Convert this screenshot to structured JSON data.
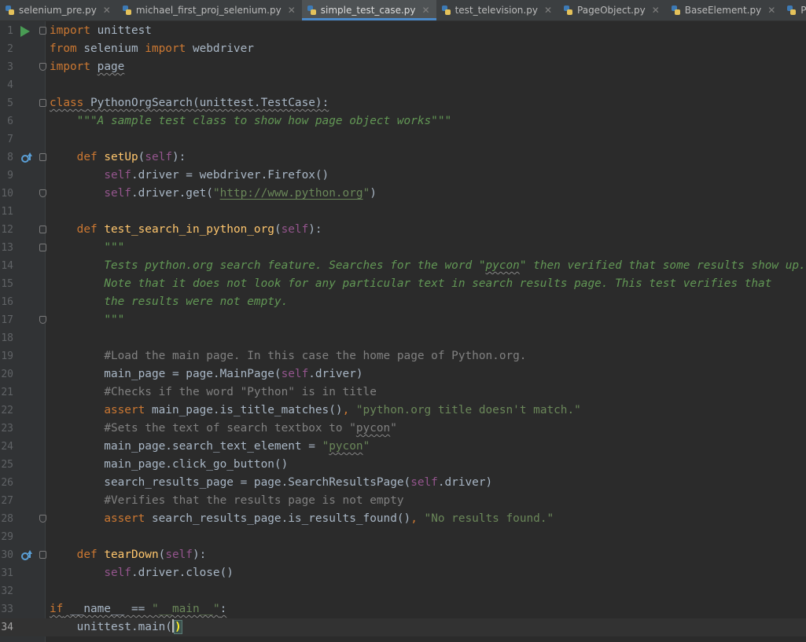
{
  "tabs": [
    {
      "label": "selenium_pre.py",
      "active": false
    },
    {
      "label": "michael_first_proj_selenium.py",
      "active": false
    },
    {
      "label": "simple_test_case.py",
      "active": true
    },
    {
      "label": "test_television.py",
      "active": false
    },
    {
      "label": "PageObject.py",
      "active": false
    },
    {
      "label": "BaseElement.py",
      "active": false
    },
    {
      "label": "PO_run.py",
      "active": false
    }
  ],
  "close_glyph": "✕",
  "current_line": 34,
  "lines": [
    {
      "n": "1",
      "code": [
        {
          "t": "kw",
          "s": "import"
        },
        {
          "t": "",
          "s": " unittest"
        }
      ]
    },
    {
      "n": "2",
      "code": [
        {
          "t": "kw",
          "s": "from"
        },
        {
          "t": "",
          "s": " selenium "
        },
        {
          "t": "kw",
          "s": "import"
        },
        {
          "t": "",
          "s": " webdriver"
        }
      ]
    },
    {
      "n": "3",
      "code": [
        {
          "t": "kw",
          "s": "import"
        },
        {
          "t": "",
          "s": " "
        },
        {
          "t": "wavy",
          "s": "page"
        }
      ]
    },
    {
      "n": "4",
      "code": []
    },
    {
      "n": "5",
      "code": [
        {
          "t": "kw wavy",
          "s": "class"
        },
        {
          "t": "wavy",
          "s": " PythonOrgSearch(unittest.TestCase):"
        }
      ]
    },
    {
      "n": "6",
      "code": [
        {
          "t": "",
          "s": "    "
        },
        {
          "t": "doc",
          "s": "\"\"\"A sample test class to show how page object works\"\"\""
        }
      ]
    },
    {
      "n": "7",
      "code": []
    },
    {
      "n": "8",
      "code": [
        {
          "t": "",
          "s": "    "
        },
        {
          "t": "kw",
          "s": "def"
        },
        {
          "t": "",
          "s": " "
        },
        {
          "t": "fn",
          "s": "setUp"
        },
        {
          "t": "",
          "s": "("
        },
        {
          "t": "self",
          "s": "self"
        },
        {
          "t": "",
          "s": "):"
        }
      ]
    },
    {
      "n": "9",
      "code": [
        {
          "t": "",
          "s": "        "
        },
        {
          "t": "self",
          "s": "self"
        },
        {
          "t": "",
          "s": ".driver = webdriver.Firefox()"
        }
      ]
    },
    {
      "n": "10",
      "code": [
        {
          "t": "",
          "s": "        "
        },
        {
          "t": "self",
          "s": "self"
        },
        {
          "t": "",
          "s": ".driver.get("
        },
        {
          "t": "str",
          "s": "\""
        },
        {
          "t": "str url",
          "s": "http://www.python.org"
        },
        {
          "t": "str",
          "s": "\""
        },
        {
          "t": "",
          "s": ")"
        }
      ]
    },
    {
      "n": "11",
      "code": []
    },
    {
      "n": "12",
      "code": [
        {
          "t": "",
          "s": "    "
        },
        {
          "t": "kw",
          "s": "def"
        },
        {
          "t": "",
          "s": " "
        },
        {
          "t": "fn",
          "s": "test_search_in_python_org"
        },
        {
          "t": "",
          "s": "("
        },
        {
          "t": "self",
          "s": "self"
        },
        {
          "t": "",
          "s": "):"
        }
      ]
    },
    {
      "n": "13",
      "code": [
        {
          "t": "",
          "s": "        "
        },
        {
          "t": "doc",
          "s": "\"\"\""
        }
      ]
    },
    {
      "n": "14",
      "code": [
        {
          "t": "",
          "s": "        "
        },
        {
          "t": "doc",
          "s": "Tests python.org search feature. Searches for the word \""
        },
        {
          "t": "doc wavy",
          "s": "pycon"
        },
        {
          "t": "doc",
          "s": "\" then verified that some results show up."
        }
      ]
    },
    {
      "n": "15",
      "code": [
        {
          "t": "",
          "s": "        "
        },
        {
          "t": "doc",
          "s": "Note that it does not look for any particular text in search results page. This test verifies that"
        }
      ]
    },
    {
      "n": "16",
      "code": [
        {
          "t": "",
          "s": "        "
        },
        {
          "t": "doc",
          "s": "the results were not empty."
        }
      ]
    },
    {
      "n": "17",
      "code": [
        {
          "t": "",
          "s": "        "
        },
        {
          "t": "doc",
          "s": "\"\"\""
        }
      ]
    },
    {
      "n": "18",
      "code": []
    },
    {
      "n": "19",
      "code": [
        {
          "t": "",
          "s": "        "
        },
        {
          "t": "cmt",
          "s": "#Load the main page. In this case the home page of Python.org."
        }
      ]
    },
    {
      "n": "20",
      "code": [
        {
          "t": "",
          "s": "        main_page = page.MainPage("
        },
        {
          "t": "self",
          "s": "self"
        },
        {
          "t": "",
          "s": ".driver)"
        }
      ]
    },
    {
      "n": "21",
      "code": [
        {
          "t": "",
          "s": "        "
        },
        {
          "t": "cmt",
          "s": "#Checks if the word \"Python\" is in title"
        }
      ]
    },
    {
      "n": "22",
      "code": [
        {
          "t": "",
          "s": "        "
        },
        {
          "t": "kw",
          "s": "assert"
        },
        {
          "t": "",
          "s": " main_page.is_title_matches()"
        },
        {
          "t": "kw",
          "s": ", "
        },
        {
          "t": "str",
          "s": "\"python.org title doesn't match.\""
        }
      ]
    },
    {
      "n": "23",
      "code": [
        {
          "t": "",
          "s": "        "
        },
        {
          "t": "cmt",
          "s": "#Sets the text of search textbox to \""
        },
        {
          "t": "cmt wavy",
          "s": "pycon"
        },
        {
          "t": "cmt",
          "s": "\""
        }
      ]
    },
    {
      "n": "24",
      "code": [
        {
          "t": "",
          "s": "        main_page.search_text_element = "
        },
        {
          "t": "str",
          "s": "\""
        },
        {
          "t": "str wavy",
          "s": "pycon"
        },
        {
          "t": "str",
          "s": "\""
        }
      ]
    },
    {
      "n": "25",
      "code": [
        {
          "t": "",
          "s": "        main_page.click_go_button()"
        }
      ]
    },
    {
      "n": "26",
      "code": [
        {
          "t": "",
          "s": "        search_results_page = page.SearchResultsPage("
        },
        {
          "t": "self",
          "s": "self"
        },
        {
          "t": "",
          "s": ".driver)"
        }
      ]
    },
    {
      "n": "27",
      "code": [
        {
          "t": "",
          "s": "        "
        },
        {
          "t": "cmt",
          "s": "#Verifies that the results page is not empty"
        }
      ]
    },
    {
      "n": "28",
      "code": [
        {
          "t": "",
          "s": "        "
        },
        {
          "t": "kw",
          "s": "assert"
        },
        {
          "t": "",
          "s": " search_results_page.is_results_found()"
        },
        {
          "t": "kw",
          "s": ", "
        },
        {
          "t": "str",
          "s": "\"No results found.\""
        }
      ]
    },
    {
      "n": "29",
      "code": []
    },
    {
      "n": "30",
      "code": [
        {
          "t": "",
          "s": "    "
        },
        {
          "t": "kw",
          "s": "def"
        },
        {
          "t": "",
          "s": " "
        },
        {
          "t": "fn",
          "s": "tearDown"
        },
        {
          "t": "",
          "s": "("
        },
        {
          "t": "self",
          "s": "self"
        },
        {
          "t": "",
          "s": "):"
        }
      ]
    },
    {
      "n": "31",
      "code": [
        {
          "t": "",
          "s": "        "
        },
        {
          "t": "self",
          "s": "self"
        },
        {
          "t": "",
          "s": ".driver.close()"
        }
      ]
    },
    {
      "n": "32",
      "code": []
    },
    {
      "n": "33",
      "code": [
        {
          "t": "kw wavy",
          "s": "if"
        },
        {
          "t": "wavy",
          "s": " __name__ == "
        },
        {
          "t": "str wavy",
          "s": "\"__main__\""
        },
        {
          "t": "wavy",
          "s": ":"
        }
      ]
    },
    {
      "n": "34",
      "code": [
        {
          "t": "",
          "s": "    unittest.main("
        },
        {
          "t": "bracematch",
          "s": ")"
        }
      ]
    }
  ]
}
